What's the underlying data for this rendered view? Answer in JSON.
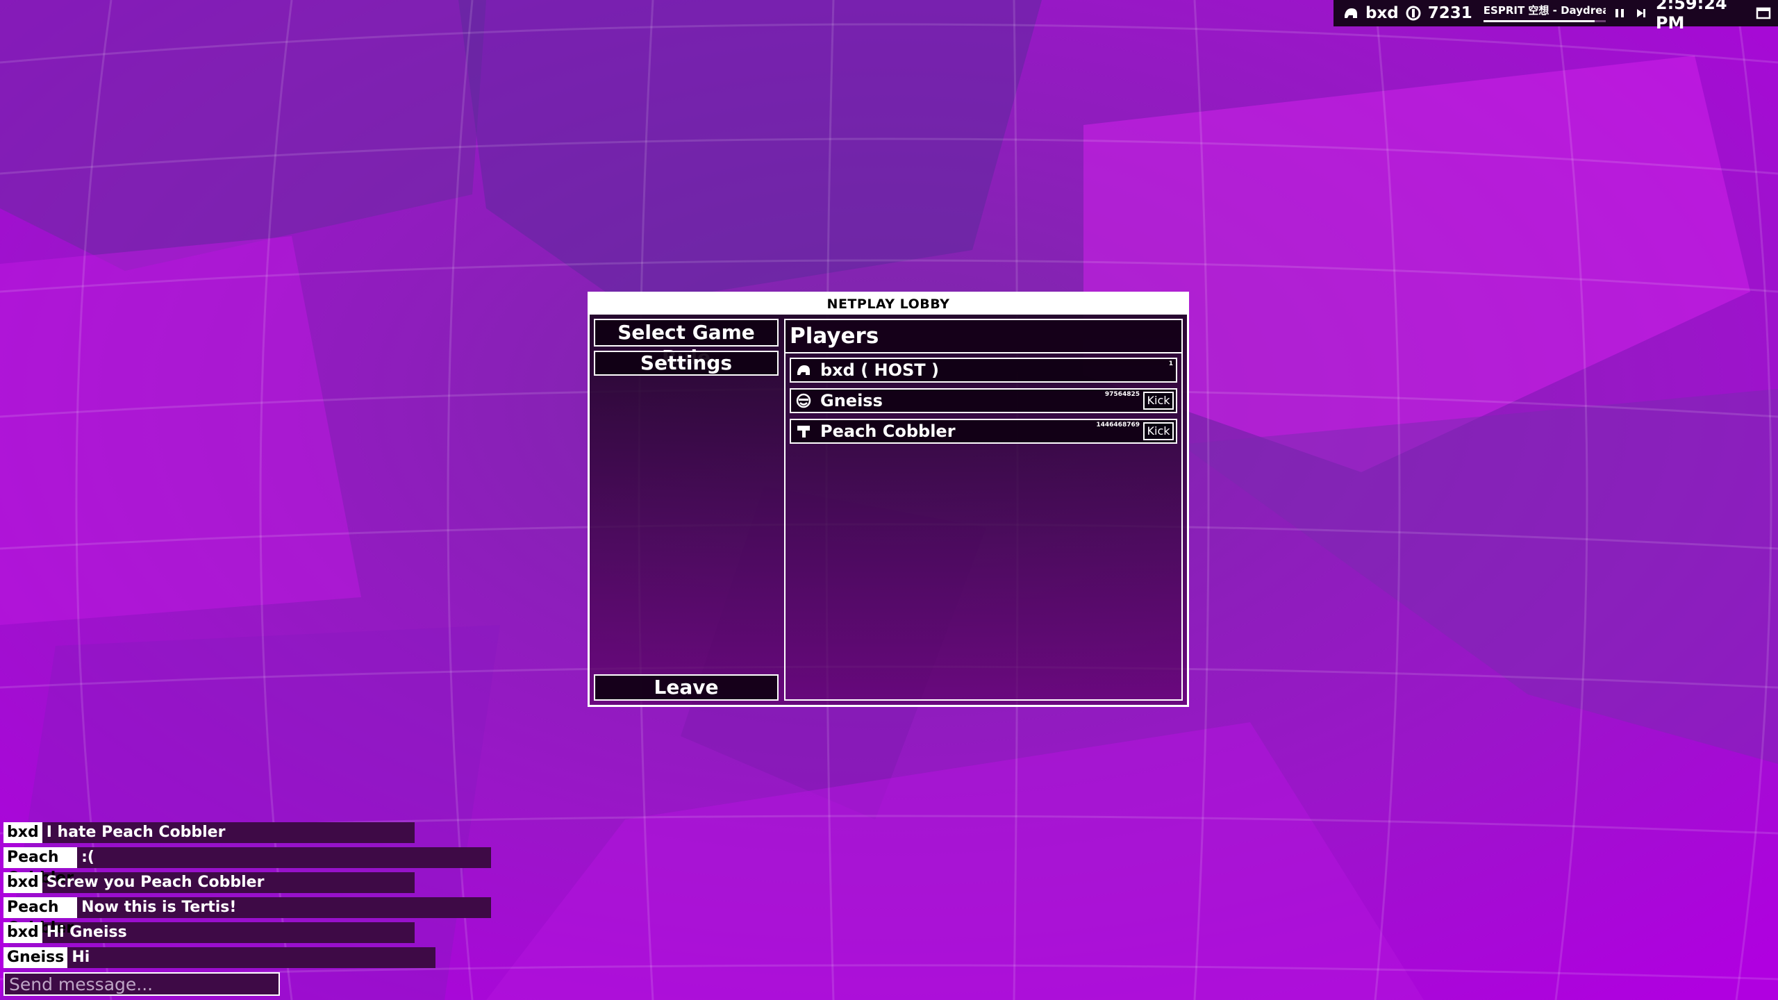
{
  "topbar": {
    "user": "bxd",
    "coins": "7231",
    "song": "ESPRIT 空想 - Daydream",
    "song_progress": 0.91,
    "time": "2:59:24 PM",
    "icons": [
      "user-icon",
      "coin-icon",
      "pause-icon",
      "skip-icon",
      "window-icon"
    ]
  },
  "lobby": {
    "title": "NETPLAY LOBBY",
    "buttons": {
      "select_game_rule": "Select Game Rule",
      "settings": "Settings",
      "leave": "Leave"
    },
    "players_title": "Players",
    "players": [
      {
        "name": "bxd ( HOST )",
        "id": "1",
        "icon": "user-icon",
        "kick": ""
      },
      {
        "name": "Gneiss",
        "id": "97564825",
        "icon": "smiley-icon",
        "kick": "Kick"
      },
      {
        "name": "Peach Cobbler",
        "id": "1446468769",
        "icon": "hammer-icon",
        "kick": "Kick"
      }
    ]
  },
  "chat": {
    "messages": [
      {
        "name": "bxd",
        "text": "I hate Peach Cobbler"
      },
      {
        "name": "Peach Cobbler",
        "text": ":("
      },
      {
        "name": "bxd",
        "text": "Screw you Peach Cobbler"
      },
      {
        "name": "Peach Cobbler",
        "text": "Now this is Tertis!"
      },
      {
        "name": "bxd",
        "text": "Hi Gneiss"
      },
      {
        "name": "Gneiss",
        "text": "Hi"
      }
    ],
    "placeholder": "Send message..."
  },
  "colors": {
    "background": "#9a10c8",
    "panel": "#14001a",
    "chat_bar": "#3e0a46",
    "accent": "#ffffff"
  }
}
